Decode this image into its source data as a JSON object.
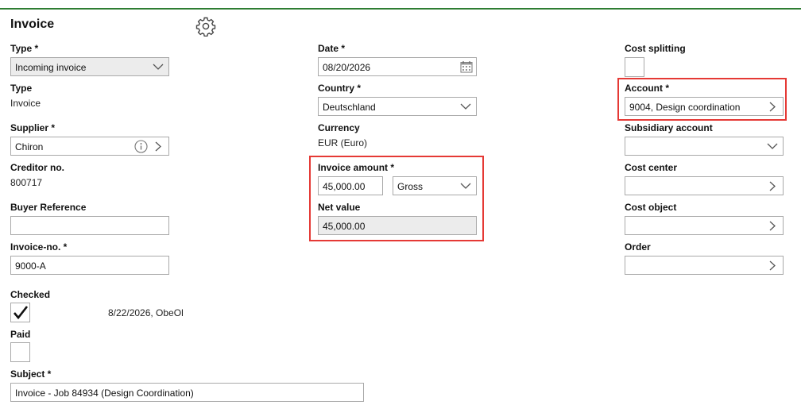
{
  "header": {
    "title": "Invoice",
    "settings_icon": "gear-icon"
  },
  "left": {
    "type_select": {
      "label": "Type *",
      "value": "Incoming invoice"
    },
    "type_static": {
      "label": "Type",
      "value": "Invoice"
    },
    "supplier": {
      "label": "Supplier *",
      "value": "Chiron"
    },
    "creditor": {
      "label": "Creditor no.",
      "value": "800717"
    },
    "buyer_reference": {
      "label": "Buyer Reference",
      "value": ""
    },
    "invoice_no": {
      "label": "Invoice-no. *",
      "value": "9000-A"
    },
    "checked": {
      "label": "Checked",
      "checked": true,
      "info": "8/22/2026, ObeOl"
    },
    "paid": {
      "label": "Paid",
      "checked": false
    },
    "subject": {
      "label": "Subject *",
      "value": "Invoice - Job 84934 (Design Coordination)"
    }
  },
  "middle": {
    "date": {
      "label": "Date *",
      "value": "08/20/2026"
    },
    "country": {
      "label": "Country *",
      "value": "Deutschland"
    },
    "currency": {
      "label": "Currency",
      "value": "EUR (Euro)"
    },
    "invoice_amount": {
      "label": "Invoice amount *",
      "value": "45,000.00",
      "mode": "Gross"
    },
    "net_value": {
      "label": "Net value",
      "value": "45,000.00"
    }
  },
  "right": {
    "cost_splitting": {
      "label": "Cost splitting",
      "checked": false
    },
    "account": {
      "label": "Account *",
      "value": "9004, Design coordination"
    },
    "subsidiary_account": {
      "label": "Subsidiary account",
      "value": ""
    },
    "cost_center": {
      "label": "Cost center",
      "value": ""
    },
    "cost_object": {
      "label": "Cost object",
      "value": ""
    },
    "order": {
      "label": "Order",
      "value": ""
    }
  },
  "colors": {
    "accent_line": "#2e7d32",
    "highlight": "#e53935",
    "border": "#a9a9a9"
  }
}
